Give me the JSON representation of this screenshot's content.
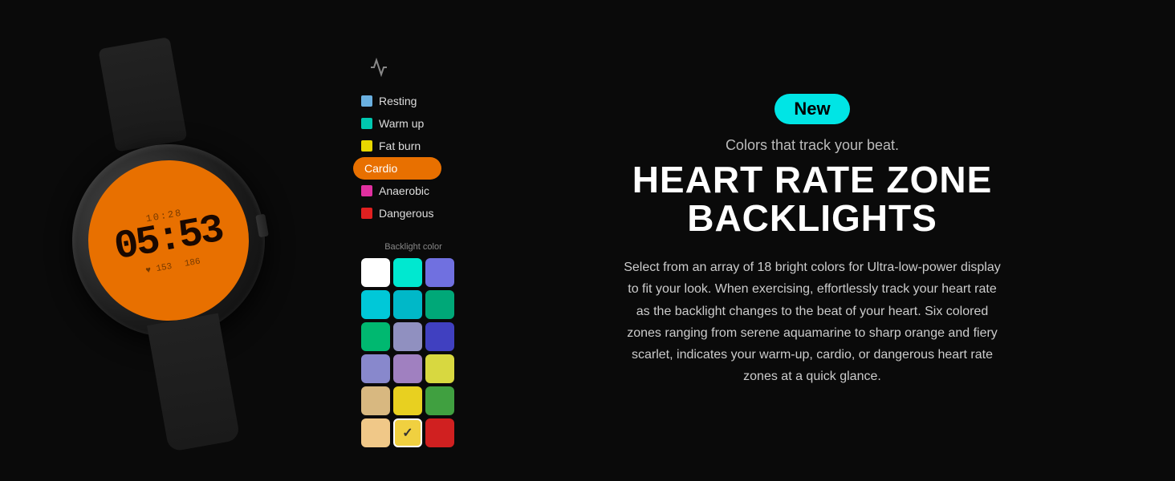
{
  "badge": {
    "label": "New"
  },
  "tagline": "Colors that track your beat.",
  "title_line1": "HEART RATE ZONE",
  "title_line2": "BACKLIGHTS",
  "description": "Select from an array of 18 bright colors for Ultra-low-power display to fit your look. When exercising, effortlessly track your heart rate as the backlight changes to the beat of your heart. Six colored zones ranging from serene aquamarine to sharp orange and fiery scarlet, indicates your warm-up, cardio, or dangerous heart rate zones at a quick glance.",
  "zones": [
    {
      "label": "Resting",
      "color": "#6ab0e0",
      "active": false
    },
    {
      "label": "Warm up",
      "color": "#00c8b0",
      "active": false
    },
    {
      "label": "Fat burn",
      "color": "#e8d800",
      "active": false
    },
    {
      "label": "Cardio",
      "color": "#e87000",
      "active": true
    },
    {
      "label": "Anaerobic",
      "color": "#e030a0",
      "active": false
    },
    {
      "label": "Dangerous",
      "color": "#e02020",
      "active": false
    }
  ],
  "palette_label": "Backlight color",
  "palette_colors": [
    "#ffffff",
    "#00e8d0",
    "#7070e0",
    "#00c8d8",
    "#00b8c8",
    "#00a878",
    "#00b870",
    "#9090c0",
    "#4040c0",
    "#8888cc",
    "#a080c0",
    "#d8d840",
    "#d8b880",
    "#e8d020",
    "#40a040",
    "#f0c888",
    "#f0d040",
    "#d02020"
  ],
  "selected_palette_index": 16,
  "watch": {
    "time_top": "10:28",
    "time_main": "05:53",
    "stat1": "♥ 153",
    "stat2": "186"
  }
}
